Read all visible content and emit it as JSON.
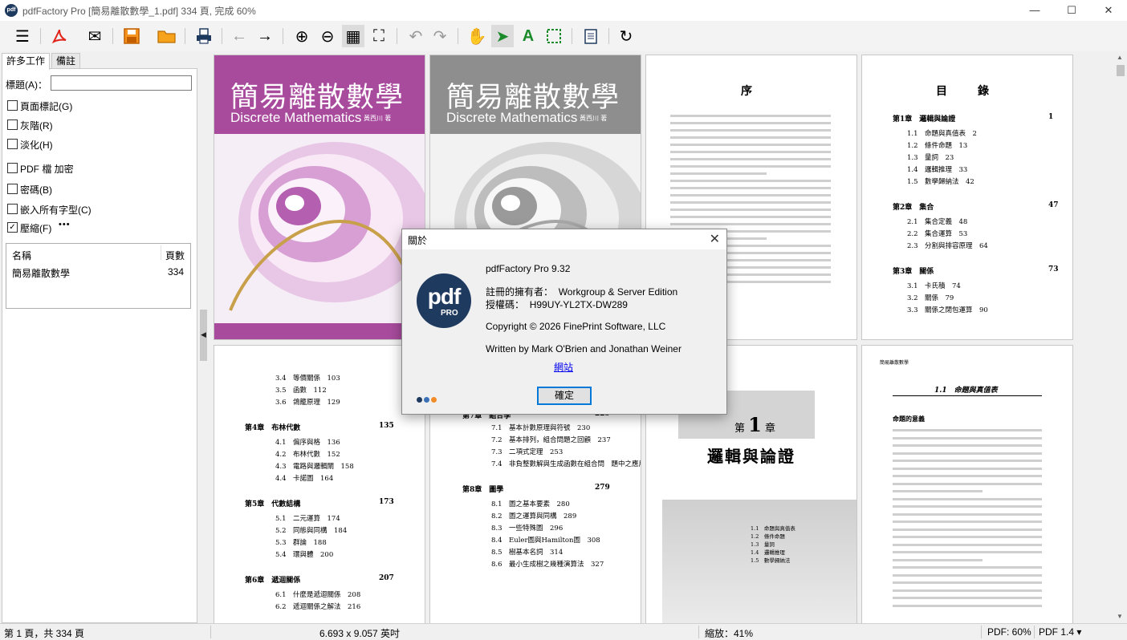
{
  "window": {
    "title": "pdfFactory Pro [簡易離散數學_1.pdf] 334 頁, 完成 60%",
    "app_icon_text": "pdf",
    "minimize_glyph": "—",
    "maximize_glyph": "☐",
    "close_glyph": "✕"
  },
  "toolbar": {
    "menu": "☰",
    "pdf": "⬚",
    "email": "✉",
    "save": "💾",
    "open": "📂",
    "print": "🖶",
    "back": "←",
    "forward": "→",
    "zoom_in": "⊕",
    "zoom_out": "⊖",
    "grid": "▦",
    "fit": "⛶",
    "undo": "↶",
    "redo": "↷",
    "hand": "✋",
    "select": "➤",
    "text": "A",
    "marquee": "⬚",
    "notes": "📋",
    "refresh": "↻"
  },
  "left_panel": {
    "tabs": [
      "許多工作",
      "備註"
    ],
    "title_label": "標題(A)：",
    "title_value": "",
    "options": [
      {
        "label": "頁面標記(G)",
        "checked": false
      },
      {
        "label": "灰階(R)",
        "checked": false
      },
      {
        "label": "淡化(H)",
        "checked": false
      },
      {
        "label": "PDF 檔 加密",
        "checked": false
      },
      {
        "label": "密碼(B)",
        "checked": false
      },
      {
        "label": "嵌入所有字型(C)",
        "checked": false
      },
      {
        "label": "壓縮(F)",
        "checked": true
      }
    ],
    "more": "•••",
    "list_headers": [
      "名稱",
      "頁數"
    ],
    "list_rows": [
      {
        "name": "簡易離散數學",
        "pages": "334"
      }
    ]
  },
  "pages": {
    "cover_title": "簡易離散數學",
    "cover_subtitle": "Discrete Mathematics",
    "cover_author": "黃西川 著",
    "preface_title": "序",
    "toc_title": "目　錄",
    "toc_right": [
      {
        "ch": "第1章",
        "title": "邏輯與論證",
        "page": "1",
        "items": [
          [
            "1.1",
            "命題與真值表",
            "2"
          ],
          [
            "1.2",
            "條件命題",
            "13"
          ],
          [
            "1.3",
            "量詞",
            "23"
          ],
          [
            "1.4",
            "邏輯推理",
            "33"
          ],
          [
            "1.5",
            "數學歸納法",
            "42"
          ]
        ]
      },
      {
        "ch": "第2章",
        "title": "集合",
        "page": "47",
        "items": [
          [
            "2.1",
            "集合定義",
            "48"
          ],
          [
            "2.2",
            "集合運算",
            "53"
          ],
          [
            "2.3",
            "分割與排容原理",
            "64"
          ]
        ]
      },
      {
        "ch": "第3章",
        "title": "關係",
        "page": "73",
        "items": [
          [
            "3.1",
            "卡氏積",
            "74"
          ],
          [
            "3.2",
            "關係",
            "79"
          ],
          [
            "3.3",
            "關係之閉包運算",
            "90"
          ]
        ]
      }
    ],
    "toc_left": [
      {
        "ch": "",
        "title": "",
        "page": "",
        "items": [
          [
            "3.4",
            "等價關係",
            "103"
          ],
          [
            "3.5",
            "函數",
            "112"
          ],
          [
            "3.6",
            "鴿籠原理",
            "129"
          ]
        ]
      },
      {
        "ch": "第4章",
        "title": "布林代數",
        "page": "135",
        "items": [
          [
            "4.1",
            "偏序與格",
            "136"
          ],
          [
            "4.2",
            "布林代數",
            "152"
          ],
          [
            "4.3",
            "電路與邏輯閘",
            "158"
          ],
          [
            "4.4",
            "卡諾圖",
            "164"
          ]
        ]
      },
      {
        "ch": "第5章",
        "title": "代數結構",
        "page": "173",
        "items": [
          [
            "5.1",
            "二元運算",
            "174"
          ],
          [
            "5.2",
            "同態與同構",
            "184"
          ],
          [
            "5.3",
            "群論",
            "188"
          ],
          [
            "5.4",
            "環與體",
            "200"
          ]
        ]
      },
      {
        "ch": "第6章",
        "title": "遞迴關係",
        "page": "207",
        "items": [
          [
            "6.1",
            "什麼是遞迴關係",
            "208"
          ],
          [
            "6.2",
            "遞迴關係之解法",
            "216"
          ]
        ]
      }
    ],
    "toc_mid_top": {
      "ch": "第7章",
      "title": "組合學",
      "page": "229"
    },
    "toc_mid": [
      {
        "ch": "",
        "title": "",
        "page": "",
        "items": [
          [
            "7.1",
            "基本計數原理與符號",
            "230"
          ],
          [
            "7.2",
            "基本排列，組合問題之回顧",
            "237"
          ],
          [
            "7.3",
            "二項式定理",
            "253"
          ],
          [
            "7.4",
            "非負整數解與生成函數在組合問",
            "題中之應用　262"
          ]
        ]
      },
      {
        "ch": "第8章",
        "title": "圖學",
        "page": "279",
        "items": [
          [
            "8.1",
            "圖之基本要素",
            "280"
          ],
          [
            "8.2",
            "圖之運算與同構",
            "289"
          ],
          [
            "8.3",
            "一些特殊圖",
            "296"
          ],
          [
            "8.4",
            "Euler圖與Hamilton圖",
            "308"
          ],
          [
            "8.5",
            "樹基本名詞",
            "314"
          ],
          [
            "8.6",
            "最小生成樹之幾種演算法",
            "327"
          ]
        ]
      }
    ],
    "chapter_label_pre": "第",
    "chapter_num": "1",
    "chapter_label_post": "章",
    "chapter_title": "邏輯與論證",
    "chapter_sections": [
      "1.1　命題與真值表",
      "1.2　條件命題",
      "1.3　量詞",
      "1.4　邏輯推理",
      "1.5　數學歸納法"
    ],
    "section_header": "簡易離散數學",
    "section_title": "1.1　命題與真值表",
    "section_sub": "命題的意義"
  },
  "dialog": {
    "title": "關於",
    "close": "✕",
    "logo_main": "pdf",
    "logo_sub": "PRO",
    "product": "pdfFactory Pro 9.32",
    "owner_label": "註冊的擁有者：",
    "owner_value": "Workgroup & Server Edition",
    "key_label": "授權碼：",
    "key_value": "H99UY-YL2TX-DW289",
    "copyright": "Copyright © 2026 FinePrint Software, LLC",
    "written": "Written by Mark O'Brien and Jonathan Weiner",
    "website": "網站",
    "ok": "確定"
  },
  "statusbar": {
    "page": "第 1 頁，共 334 頁",
    "size": "6.693 x 9.057 英吋",
    "zoom": "縮放：41%",
    "pdf_progress": "PDF: 60%",
    "pdf_version": "PDF 1.4 ▾"
  },
  "colors": {
    "cover_purple": "#a84b9d",
    "cover_gray": "#8e8e8e",
    "logo_navy": "#1f3a5f",
    "ok_border": "#0078d7",
    "dot_blue": "#1f3a5f",
    "dot_mid": "#3b6fb6",
    "dot_orange": "#f28c28"
  }
}
